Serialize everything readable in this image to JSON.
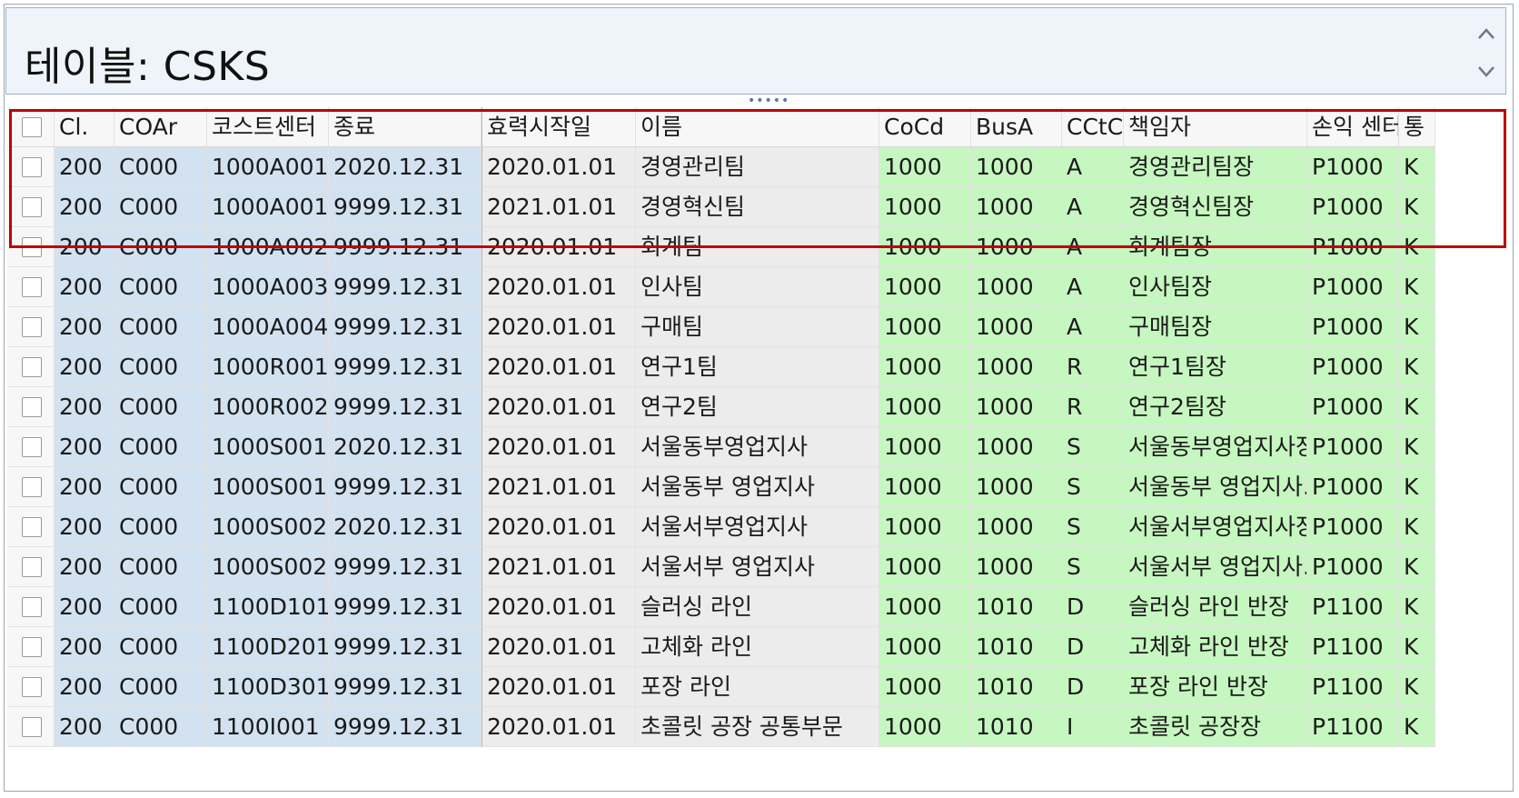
{
  "title": "테이블: CSKS",
  "icons": {
    "scroll_up": "chevron-up-icon",
    "scroll_down": "chevron-down-icon",
    "splitter": "splitter-handle-icon"
  },
  "colors": {
    "key_column": "#d2e2f0",
    "highlight_column": "#c6f7c0",
    "selection_frame": "#c00000"
  },
  "table": {
    "headers": [
      "Cl.",
      "COAr",
      "코스트센터",
      "종료",
      "효력시작일",
      "이름",
      "CoCd",
      "BusA",
      "CCtC",
      "책임자",
      "손익 센터",
      "통"
    ],
    "rows": [
      [
        "200",
        "C000",
        "1000A001",
        "2020.12.31",
        "2020.01.01",
        "경영관리팀",
        "1000",
        "1000",
        "A",
        "경영관리팀장",
        "P1000",
        "K"
      ],
      [
        "200",
        "C000",
        "1000A001",
        "9999.12.31",
        "2021.01.01",
        "경영혁신팀",
        "1000",
        "1000",
        "A",
        "경영혁신팀장",
        "P1000",
        "K"
      ],
      [
        "200",
        "C000",
        "1000A002",
        "9999.12.31",
        "2020.01.01",
        "회계팀",
        "1000",
        "1000",
        "A",
        "회계팀장",
        "P1000",
        "K"
      ],
      [
        "200",
        "C000",
        "1000A003",
        "9999.12.31",
        "2020.01.01",
        "인사팀",
        "1000",
        "1000",
        "A",
        "인사팀장",
        "P1000",
        "K"
      ],
      [
        "200",
        "C000",
        "1000A004",
        "9999.12.31",
        "2020.01.01",
        "구매팀",
        "1000",
        "1000",
        "A",
        "구매팀장",
        "P1000",
        "K"
      ],
      [
        "200",
        "C000",
        "1000R001",
        "9999.12.31",
        "2020.01.01",
        "연구1팀",
        "1000",
        "1000",
        "R",
        "연구1팀장",
        "P1000",
        "K"
      ],
      [
        "200",
        "C000",
        "1000R002",
        "9999.12.31",
        "2020.01.01",
        "연구2팀",
        "1000",
        "1000",
        "R",
        "연구2팀장",
        "P1000",
        "K"
      ],
      [
        "200",
        "C000",
        "1000S001",
        "2020.12.31",
        "2020.01.01",
        "서울동부영업지사",
        "1000",
        "1000",
        "S",
        "서울동부영업지사장",
        "P1000",
        "K"
      ],
      [
        "200",
        "C000",
        "1000S001",
        "9999.12.31",
        "2021.01.01",
        "서울동부 영업지사",
        "1000",
        "1000",
        "S",
        "서울동부 영업지사...",
        "P1000",
        "K"
      ],
      [
        "200",
        "C000",
        "1000S002",
        "2020.12.31",
        "2020.01.01",
        "서울서부영업지사",
        "1000",
        "1000",
        "S",
        "서울서부영업지사장",
        "P1000",
        "K"
      ],
      [
        "200",
        "C000",
        "1000S002",
        "9999.12.31",
        "2021.01.01",
        "서울서부 영업지사",
        "1000",
        "1000",
        "S",
        "서울서부 영업지사...",
        "P1000",
        "K"
      ],
      [
        "200",
        "C000",
        "1100D101",
        "9999.12.31",
        "2020.01.01",
        "슬러싱 라인",
        "1000",
        "1010",
        "D",
        "슬러싱 라인 반장",
        "P1100",
        "K"
      ],
      [
        "200",
        "C000",
        "1100D201",
        "9999.12.31",
        "2020.01.01",
        "고체화 라인",
        "1000",
        "1010",
        "D",
        "고체화 라인 반장",
        "P1100",
        "K"
      ],
      [
        "200",
        "C000",
        "1100D301",
        "9999.12.31",
        "2020.01.01",
        "포장 라인",
        "1000",
        "1010",
        "D",
        "포장 라인 반장",
        "P1100",
        "K"
      ],
      [
        "200",
        "C000",
        "1100I001",
        "9999.12.31",
        "2020.01.01",
        "초콜릿 공장 공통부문",
        "1000",
        "1010",
        "I",
        "초콜릿 공장장",
        "P1100",
        "K"
      ]
    ]
  }
}
